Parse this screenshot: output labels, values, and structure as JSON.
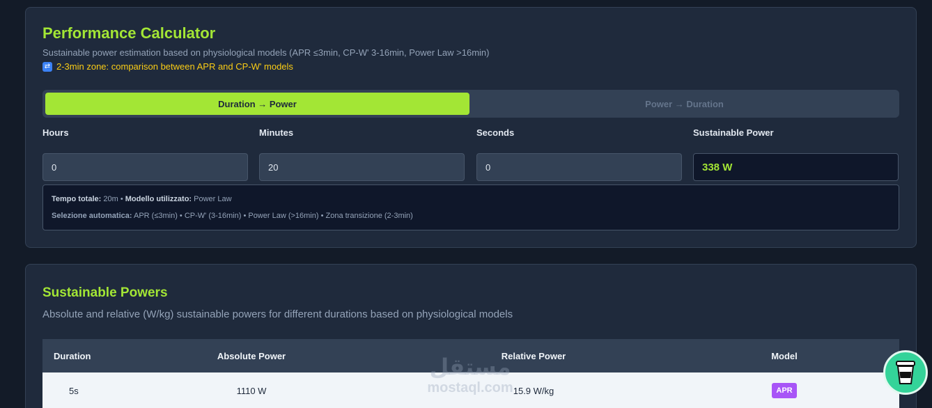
{
  "calculator": {
    "title": "Performance Calculator",
    "subtitle": "Sustainable power estimation based on physiological models (APR ≤3min, CP-W' 3-16min, Power Law >16min)",
    "notice_icon": "shuffle-icon",
    "notice": "2-3min zone: comparison between APR and CP-W' models",
    "mode_tabs": [
      {
        "label": "Duration → Power",
        "active": true
      },
      {
        "label": "Power → Duration",
        "active": false
      }
    ],
    "fields": {
      "hours": {
        "label": "Hours",
        "value": "0"
      },
      "minutes": {
        "label": "Minutes",
        "value": "20"
      },
      "seconds": {
        "label": "Seconds",
        "value": "0"
      },
      "power": {
        "label": "Sustainable Power",
        "value": "338 W"
      }
    },
    "info": {
      "total_time_label": "Tempo totale:",
      "total_time_value": "20m",
      "separator": "•",
      "model_label": "Modello utilizzato:",
      "model_value": "Power Law",
      "auto_label": "Selezione automatica:",
      "auto_value": "APR (≤3min) • CP-W' (3-16min) • Power Law (>16min) • Zona transizione (2-3min)"
    }
  },
  "powers": {
    "title": "Sustainable Powers",
    "subtitle": "Absolute and relative (W/kg) sustainable powers for different durations based on physiological models",
    "columns": [
      "Duration",
      "Absolute Power",
      "Relative Power",
      "Model"
    ],
    "rows": [
      {
        "duration": "5s",
        "absolute": "1110 W",
        "relative": "15.9 W/kg",
        "model": "APR"
      }
    ]
  },
  "watermark": {
    "arabic": "مستقل",
    "latin": "mostaql.com"
  },
  "colors": {
    "accent": "#a3e635",
    "warning": "#facc15",
    "badge_apr": "#a855f7",
    "floating_button": "#34d399"
  },
  "floating_button_icon": "coffee-cup-icon"
}
